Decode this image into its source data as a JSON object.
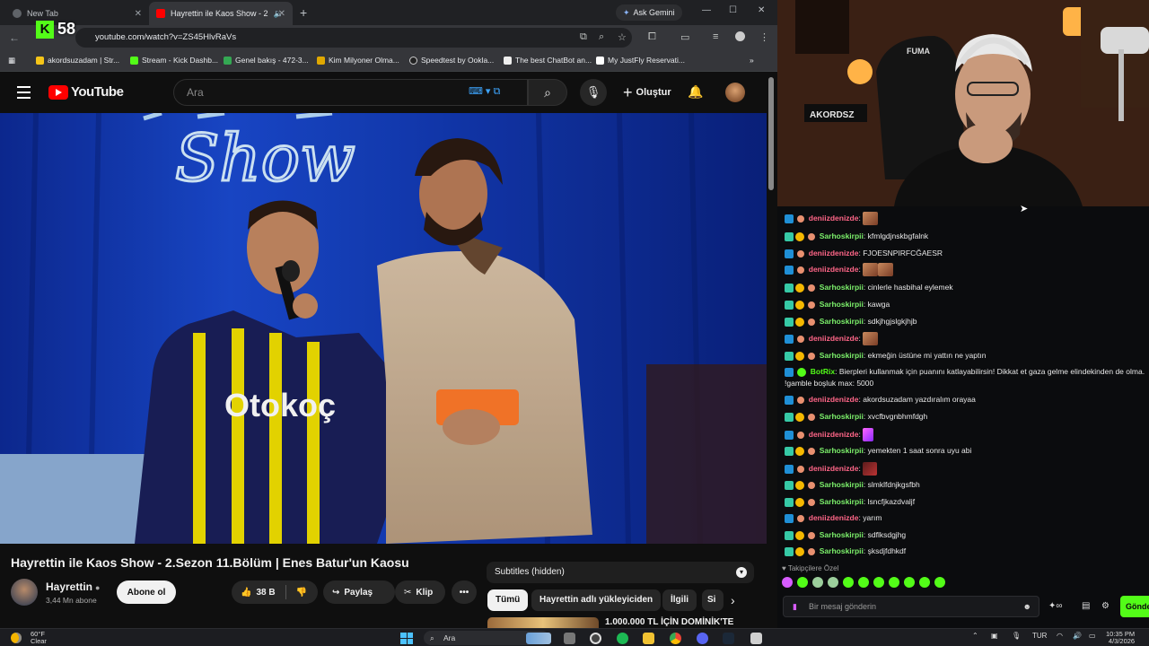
{
  "browser": {
    "tabs": [
      {
        "title": "New Tab",
        "active": false
      },
      {
        "title": "Hayrettin ile Kaos Show - 2",
        "active": true
      }
    ],
    "ask_gemini": "Ask Gemini",
    "url": "youtube.com/watch?v=ZS45HlvRaVs",
    "kick_badge": "58",
    "bookmarks": [
      "akordsuzadam | Str...",
      "Stream - Kick Dashb...",
      "Genel bakış - 472-3...",
      "Kim Milyoner Olma...",
      "Speedtest by Ookla...",
      "The best ChatBot an...",
      "My JustFly Reservati..."
    ]
  },
  "youtube": {
    "logo_text": "YouTube",
    "search_placeholder": "Ara",
    "create_label": "Oluştur",
    "video_title": "Hayrettin ile Kaos Show - 2.Sezon 11.Bölüm | Enes Batur'un Kaosu",
    "channel": {
      "name": "Hayrettin",
      "subs": "3,44 Mn abone"
    },
    "subscribe_label": "Abone ol",
    "like_count": "38 B",
    "share_label": "Paylaş",
    "clip_label": "Klip",
    "subtitles_label": "Subtitles (hidden)",
    "chips": [
      "Tümü",
      "Hayrettin adlı yükleyiciden",
      "İlgili",
      "Si"
    ],
    "rec_title": "1.000.000 TL İÇİN DOMİNİK'TE",
    "video_overlay": {
      "neon_text": "Show",
      "jersey_text": "Otokoç",
      "brand_mark": "FUMA"
    }
  },
  "webcam": {
    "banner_text": "AKORDSZ"
  },
  "chat": {
    "messages": [
      {
        "user": "deniizdenizde",
        "text": "",
        "emote": "emote"
      },
      {
        "user": "Sarhoskirpii",
        "text": "kfmlgdjnskbgfalnk"
      },
      {
        "user": "deniizdenizde",
        "text": "FJOESNPIRFCĞAESR"
      },
      {
        "user": "deniizdenizde",
        "text": "",
        "emote": "emote2"
      },
      {
        "user": "Sarhoskirpii",
        "text": "cinlerle hasbihal eylemek"
      },
      {
        "user": "Sarhoskirpii",
        "text": "kawga"
      },
      {
        "user": "Sarhoskirpii",
        "text": "sdkjhgjslgkjhjb"
      },
      {
        "user": "deniizdenizde",
        "text": "",
        "emote": "emote"
      },
      {
        "user": "Sarhoskirpii",
        "text": "ekmeğin üstüne mi yattın ne yaptın"
      },
      {
        "user": "BotRix",
        "text": "Bierpleri kullanmak için puanını katlayabilirsin! Dikkat et gaza gelme elindekinden de olma. !gamble boşluk max: 5000"
      },
      {
        "user": "deniizdenizde",
        "text": "akordsuzadam yazdıralım orayaa"
      },
      {
        "user": "Sarhoskirpii",
        "text": "xvcfbvgnbhmfdgh"
      },
      {
        "user": "deniizdenizde",
        "text": "",
        "emote": "pink"
      },
      {
        "user": "Sarhoskirpii",
        "text": "yemekten 1 saat sonra uyu abi"
      },
      {
        "user": "deniizdenizde",
        "text": "",
        "emote": "red"
      },
      {
        "user": "Sarhoskirpii",
        "text": "slmklfdnjkgsfbh"
      },
      {
        "user": "Sarhoskirpii",
        "text": "lsncfjkazdvaljf"
      },
      {
        "user": "deniizdenizde",
        "text": "yarım"
      },
      {
        "user": "Sarhoskirpii",
        "text": "sdflksdgjhg"
      },
      {
        "user": "Sarhoskirpii",
        "text": "şksdjfdhkdf"
      }
    ],
    "followers_only_label": "Takipçilere Özel",
    "input_placeholder": "Bir mesaj gönderin",
    "send_label": "Gönder",
    "points_label": "∞"
  },
  "taskbar": {
    "temp": "60°F",
    "weather": "Clear",
    "search_label": "Ara",
    "lang": "TUR",
    "time": "10:35 PM",
    "date": "4/3/2026"
  }
}
